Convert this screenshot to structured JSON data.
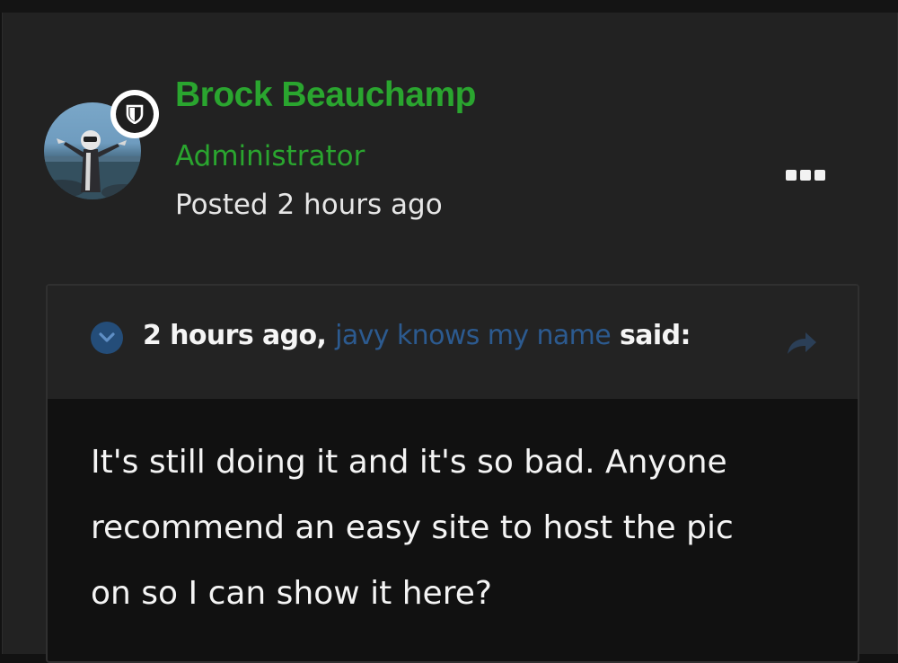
{
  "post": {
    "author_name": "Brock Beauchamp",
    "author_role": "Administrator",
    "posted_time": "Posted 2 hours ago",
    "name_color": "#2aa52f"
  },
  "quote": {
    "time": "2 hours ago,",
    "quoted_user": "javy knows my name",
    "said": "said:",
    "body_lines": [
      "It's still doing it and it's so bad. Anyone",
      "recommend an easy site to host the pic",
      "on so I can show it here?"
    ]
  },
  "icons": {
    "badge": "shield-icon",
    "more": "more-options-icon",
    "toggle": "chevron-down-icon",
    "share": "share-arrow-icon"
  }
}
